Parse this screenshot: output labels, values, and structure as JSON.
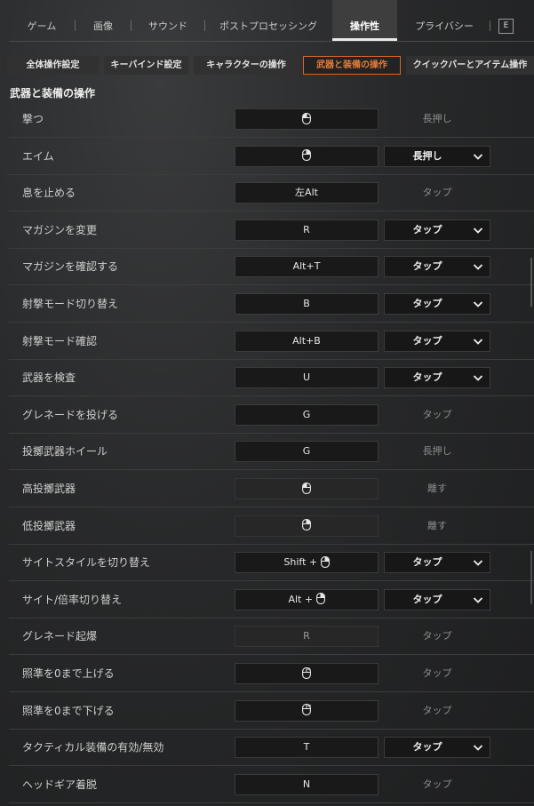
{
  "top_tabs": [
    {
      "label": "ゲーム",
      "active": false
    },
    {
      "label": "画像",
      "active": false
    },
    {
      "label": "サウンド",
      "active": false
    },
    {
      "label": "ポストプロセッシング",
      "active": false
    },
    {
      "label": "操作性",
      "active": true
    },
    {
      "label": "プライバシー",
      "active": false
    }
  ],
  "top_tabs_key_hint": "E",
  "sub_tabs": [
    {
      "label": "全体操作設定",
      "active": false
    },
    {
      "label": "キーバインド設定",
      "active": false
    },
    {
      "label": "キャラクターの操作",
      "active": false
    },
    {
      "label": "武器と装備の操作",
      "active": true
    },
    {
      "label": "クイックバーとアイテム操作",
      "active": false
    }
  ],
  "section_title": "武器と装備の操作",
  "bindings": [
    {
      "label": "撃つ",
      "key": "",
      "mouse": "left",
      "mode": "長押し",
      "dropdown": false,
      "dim": false
    },
    {
      "label": "エイム",
      "key": "",
      "mouse": "right",
      "mode": "長押し",
      "dropdown": true,
      "dim": false
    },
    {
      "label": "息を止める",
      "key": "左Alt",
      "mouse": "",
      "mode": "タップ",
      "dropdown": false,
      "dim": false
    },
    {
      "label": "マガジンを変更",
      "key": "R",
      "mouse": "",
      "mode": "タップ",
      "dropdown": true,
      "dim": false
    },
    {
      "label": "マガジンを確認する",
      "key": "Alt+T",
      "mouse": "",
      "mode": "タップ",
      "dropdown": true,
      "dim": false
    },
    {
      "label": "射撃モード切り替え",
      "key": "B",
      "mouse": "",
      "mode": "タップ",
      "dropdown": true,
      "dim": false
    },
    {
      "label": "射撃モード確認",
      "key": "Alt+B",
      "mouse": "",
      "mode": "タップ",
      "dropdown": true,
      "dim": false
    },
    {
      "label": "武器を検査",
      "key": "U",
      "mouse": "",
      "mode": "タップ",
      "dropdown": true,
      "dim": false
    },
    {
      "label": "グレネードを投げる",
      "key": "G",
      "mouse": "",
      "mode": "タップ",
      "dropdown": false,
      "dim": false
    },
    {
      "label": "投擲武器ホイール",
      "key": "G",
      "mouse": "",
      "mode": "長押し",
      "dropdown": false,
      "dim": false
    },
    {
      "label": "高投擲武器",
      "key": "",
      "mouse": "left",
      "mode": "離す",
      "dropdown": false,
      "dim": true
    },
    {
      "label": "低投擲武器",
      "key": "",
      "mouse": "right",
      "mode": "離す",
      "dropdown": false,
      "dim": true
    },
    {
      "label": "サイトスタイルを切り替え",
      "key": "Shift + ",
      "mouse": "right",
      "mode": "タップ",
      "dropdown": true,
      "dim": false
    },
    {
      "label": "サイト/倍率切り替え",
      "key": "Alt + ",
      "mouse": "right",
      "mode": "タップ",
      "dropdown": true,
      "dim": false
    },
    {
      "label": "グレネード起爆",
      "key": "R",
      "mouse": "",
      "mode": "タップ",
      "dropdown": false,
      "dim": true
    },
    {
      "label": "照準を0まで上げる",
      "key": "",
      "mouse": "wheel-up",
      "mode": "タップ",
      "dropdown": false,
      "dim": false
    },
    {
      "label": "照準を0まで下げる",
      "key": "",
      "mouse": "wheel-down",
      "mode": "タップ",
      "dropdown": false,
      "dim": false
    },
    {
      "label": "タクティカル装備の有効/無効",
      "key": "T",
      "mouse": "",
      "mode": "タップ",
      "dropdown": true,
      "dim": false
    },
    {
      "label": "ヘッドギア着脱",
      "key": "N",
      "mouse": "",
      "mode": "タップ",
      "dropdown": false,
      "dim": false
    }
  ]
}
